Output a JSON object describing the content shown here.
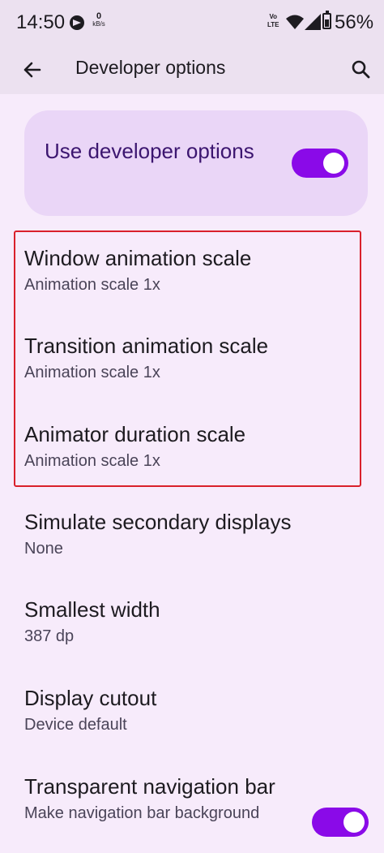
{
  "status_bar": {
    "time": "14:50",
    "net_speed_value": "0",
    "net_speed_unit": "kB/s",
    "volte_top": "Vo",
    "volte_bottom": "LTE",
    "battery_percent": "56%"
  },
  "app_bar": {
    "title": "Developer options"
  },
  "master": {
    "label": "Use developer options",
    "enabled": true
  },
  "settings": [
    {
      "title": "Window animation scale",
      "summary": "Animation scale 1x"
    },
    {
      "title": "Transition animation scale",
      "summary": "Animation scale 1x"
    },
    {
      "title": "Animator duration scale",
      "summary": "Animation scale 1x"
    },
    {
      "title": "Simulate secondary displays",
      "summary": "None"
    },
    {
      "title": "Smallest width",
      "summary": "387 dp"
    },
    {
      "title": "Display cutout",
      "summary": "Device default"
    },
    {
      "title": "Transparent navigation bar",
      "summary": "Make navigation bar background",
      "toggle_on": true
    }
  ],
  "colors": {
    "accent": "#8a0ae8",
    "card": "#ead6f7",
    "background": "#f7ebfb",
    "highlight": "#d9202b"
  }
}
